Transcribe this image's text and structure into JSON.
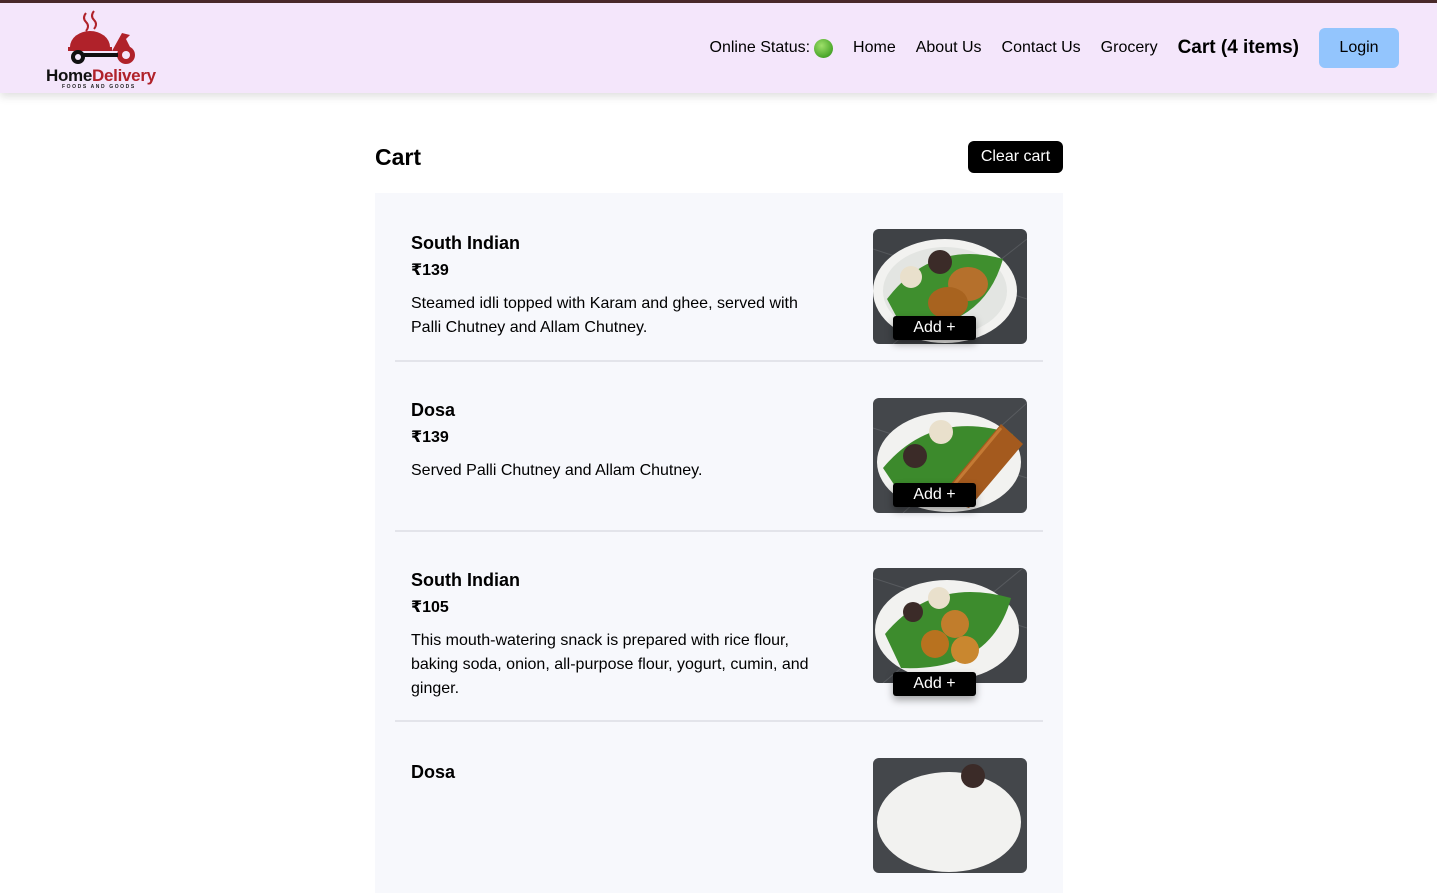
{
  "header": {
    "logo": {
      "word_home": "Home",
      "word_delivery": "Delivery",
      "tagline": "FOODS AND GOODS",
      "icon": "scooter-cloche-icon"
    },
    "nav": {
      "online_status_label": "Online Status:",
      "online_status_icon": "green-dot-icon",
      "home": "Home",
      "about": "About Us",
      "contact": "Contact Us",
      "grocery": "Grocery",
      "cart": "Cart (4 items)",
      "login": "Login"
    }
  },
  "cart": {
    "title": "Cart",
    "clear_label": "Clear cart",
    "items": [
      {
        "name": "South Indian",
        "price": "₹139",
        "description": "Steamed idli topped with Karam and ghee, served with Palli Chutney and Allam Chutney.",
        "add_label": "Add +",
        "image": "idli-plate"
      },
      {
        "name": "Dosa",
        "price": "₹139",
        "description": "Served Palli Chutney and Allam Chutney.",
        "add_label": "Add +",
        "image": "dosa-plate"
      },
      {
        "name": "South Indian",
        "price": "₹105",
        "description": "This mouth-watering snack is prepared with rice flour, baking soda, onion, all-purpose flour, yogurt, cumin, and ginger.",
        "add_label": "Add +",
        "image": "bonda-plate"
      },
      {
        "name": "Dosa",
        "image": "dosa-plate"
      }
    ]
  },
  "colors": {
    "header_bg": "#f4e6fb",
    "login_bg": "#93c5fd",
    "list_bg": "#f7f8fc",
    "brand_red": "#b0222a"
  }
}
